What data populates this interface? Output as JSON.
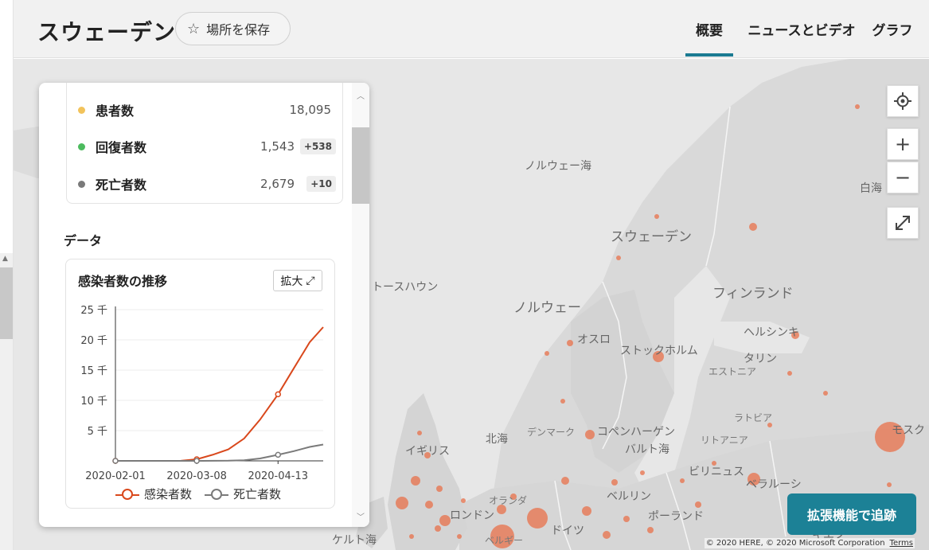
{
  "header": {
    "title": "スウェーデン",
    "save_label": "場所を保存",
    "tabs": [
      {
        "label": "概要",
        "active": true
      },
      {
        "label": "ニュースとビデオ",
        "active": false
      },
      {
        "label": "グラフ",
        "active": false
      }
    ]
  },
  "stats": [
    {
      "name": "患者数",
      "value": "18,095",
      "delta": "",
      "color": "#f2c35b"
    },
    {
      "name": "回復者数",
      "value": "1,543",
      "delta": "+538",
      "color": "#4cbb5e"
    },
    {
      "name": "死亡者数",
      "value": "2,679",
      "delta": "+10",
      "color": "#7a7a7a"
    }
  ],
  "data_section_title": "データ",
  "chart_card": {
    "title": "感染者数の推移",
    "expand_label": "拡大",
    "expand_icon": "expand-arrow-icon"
  },
  "chart_data": {
    "type": "line",
    "title": "感染者数の推移",
    "x_tick_labels": [
      "2020-02-01",
      "2020-03-08",
      "2020-04-13"
    ],
    "y_tick_labels": [
      "25 千",
      "20 千",
      "15 千",
      "10 千",
      "5 千"
    ],
    "ylim": [
      0,
      25000
    ],
    "grid": true,
    "legend_position": "bottom",
    "series": [
      {
        "name": "感染者数",
        "color": "#d9481c",
        "dates": [
          "2020-02-01",
          "2020-02-15",
          "2020-03-01",
          "2020-03-08",
          "2020-03-15",
          "2020-03-22",
          "2020-03-29",
          "2020-04-05",
          "2020-04-13",
          "2020-04-20",
          "2020-04-27",
          "2020-05-03"
        ],
        "values": [
          1,
          1,
          14,
          260,
          1000,
          1900,
          3700,
          6800,
          11000,
          15300,
          19600,
          22100
        ]
      },
      {
        "name": "死亡者数",
        "color": "#7a7a7a",
        "dates": [
          "2020-02-01",
          "2020-03-08",
          "2020-03-22",
          "2020-03-29",
          "2020-04-05",
          "2020-04-13",
          "2020-04-20",
          "2020-04-27",
          "2020-05-03"
        ],
        "values": [
          0,
          0,
          20,
          100,
          400,
          1000,
          1600,
          2300,
          2700
        ]
      }
    ]
  },
  "map": {
    "labels": [
      {
        "text": "ノルウェー海",
        "cls": ""
      },
      {
        "text": "スウェーデン",
        "cls": "big"
      },
      {
        "text": "ノルウェー",
        "cls": "big"
      },
      {
        "text": "フィンランド",
        "cls": "big"
      },
      {
        "text": "トースハウン",
        "cls": ""
      },
      {
        "text": "オスロ",
        "cls": ""
      },
      {
        "text": "ストックホルム",
        "cls": ""
      },
      {
        "text": "ヘルシンキ",
        "cls": ""
      },
      {
        "text": "タリン",
        "cls": ""
      },
      {
        "text": "エストニア",
        "cls": "sm"
      },
      {
        "text": "ラトビア",
        "cls": "sm"
      },
      {
        "text": "リトアニア",
        "cls": "sm"
      },
      {
        "text": "北海",
        "cls": ""
      },
      {
        "text": "デンマーク",
        "cls": "sm"
      },
      {
        "text": "コペンハーゲン",
        "cls": ""
      },
      {
        "text": "バルト海",
        "cls": ""
      },
      {
        "text": "ビリニュス",
        "cls": ""
      },
      {
        "text": "ベラルーシ",
        "cls": ""
      },
      {
        "text": "イギリス",
        "cls": ""
      },
      {
        "text": "オランダ",
        "cls": "sm"
      },
      {
        "text": "ロンドン",
        "cls": ""
      },
      {
        "text": "ベルリン",
        "cls": ""
      },
      {
        "text": "ポーランド",
        "cls": ""
      },
      {
        "text": "ドイツ",
        "cls": ""
      },
      {
        "text": "ベルギー",
        "cls": "sm"
      },
      {
        "text": "ケルト海",
        "cls": ""
      },
      {
        "text": "モスク",
        "cls": ""
      },
      {
        "text": "白海",
        "cls": ""
      },
      {
        "text": "キエフ",
        "cls": ""
      }
    ],
    "buttons": {
      "locate_icon": "crosshair-icon",
      "zoom_in": "+",
      "zoom_out": "−",
      "fullscreen_icon": "expand-icon"
    },
    "track_label": "拡張機能で追跡",
    "copyright": "© 2020 HERE, © 2020 Microsoft Corporation",
    "terms": "Terms"
  }
}
